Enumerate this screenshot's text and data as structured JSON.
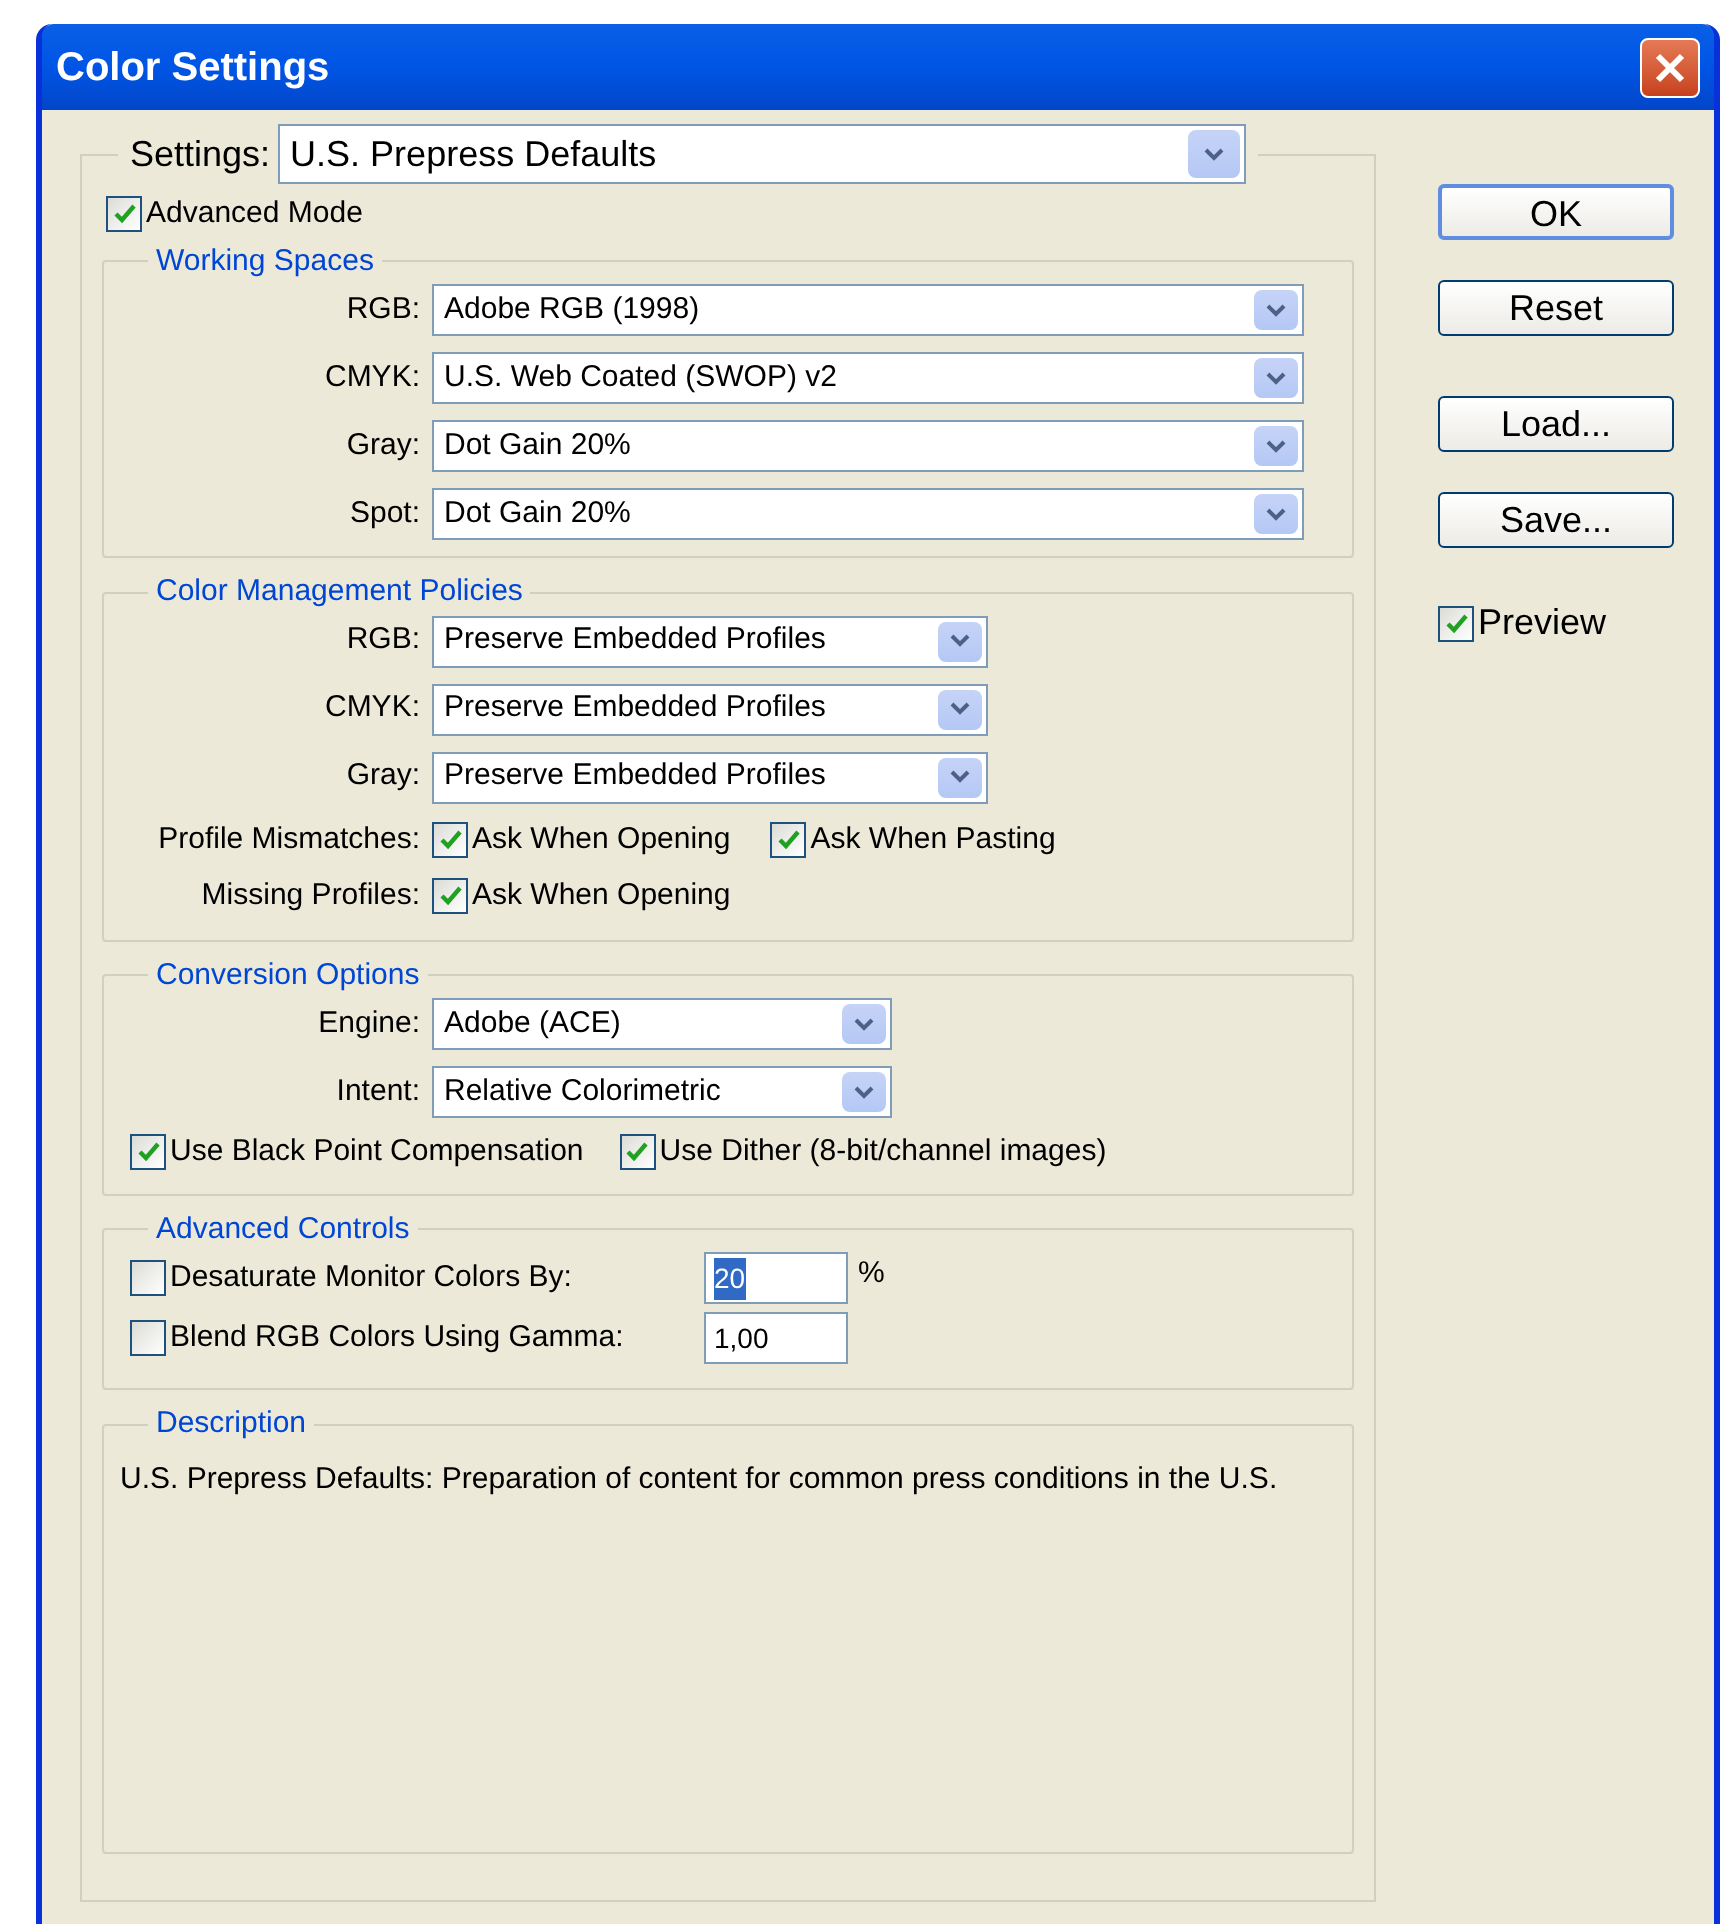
{
  "window": {
    "title": "Color Settings"
  },
  "settings": {
    "label": "Settings:",
    "value": "U.S. Prepress Defaults"
  },
  "advanced_mode": {
    "label": "Advanced Mode",
    "checked": true
  },
  "working_spaces": {
    "title": "Working Spaces",
    "rows": [
      {
        "label": "RGB:",
        "value": "Adobe RGB (1998)"
      },
      {
        "label": "CMYK:",
        "value": "U.S. Web Coated (SWOP) v2"
      },
      {
        "label": "Gray:",
        "value": "Dot Gain 20%"
      },
      {
        "label": "Spot:",
        "value": "Dot Gain 20%"
      }
    ]
  },
  "policies": {
    "title": "Color Management Policies",
    "rows": [
      {
        "label": "RGB:",
        "value": "Preserve Embedded Profiles"
      },
      {
        "label": "CMYK:",
        "value": "Preserve Embedded Profiles"
      },
      {
        "label": "Gray:",
        "value": "Preserve Embedded Profiles"
      }
    ],
    "options": [
      {
        "label": "Profile Mismatches:",
        "checkboxes": [
          {
            "label": "Ask When Opening",
            "checked": true
          },
          {
            "label": "Ask When Pasting",
            "checked": true
          }
        ]
      },
      {
        "label": "Missing Profiles:",
        "checkboxes": [
          {
            "label": "Ask When Opening",
            "checked": true
          }
        ]
      }
    ]
  },
  "conversion": {
    "title": "Conversion Options",
    "rows": [
      {
        "label": "Engine:",
        "value": "Adobe (ACE)"
      },
      {
        "label": "Intent:",
        "value": "Relative Colorimetric"
      }
    ],
    "checkboxes": [
      {
        "label": "Use Black Point Compensation",
        "checked": true
      },
      {
        "label": "Use Dither (8-bit/channel images)",
        "checked": true
      }
    ]
  },
  "advanced_controls": {
    "title": "Advanced Controls",
    "rows": [
      {
        "label": "Desaturate Monitor Colors By:",
        "checked": false,
        "value": "20",
        "highlighted": true,
        "unit": "%"
      },
      {
        "label": "Blend RGB Colors Using Gamma:",
        "checked": false,
        "value": "1,00",
        "highlighted": false
      }
    ]
  },
  "description": {
    "title": "Description",
    "text": "U.S. Prepress Defaults:  Preparation of content for common press conditions in the U.S."
  },
  "buttons": [
    {
      "label": "OK",
      "default": true
    },
    {
      "label": "Reset",
      "default": false
    },
    {
      "label": "Load...",
      "default": false
    },
    {
      "label": "Save...",
      "default": false
    }
  ],
  "preview": {
    "label": "Preview",
    "checked": true
  }
}
